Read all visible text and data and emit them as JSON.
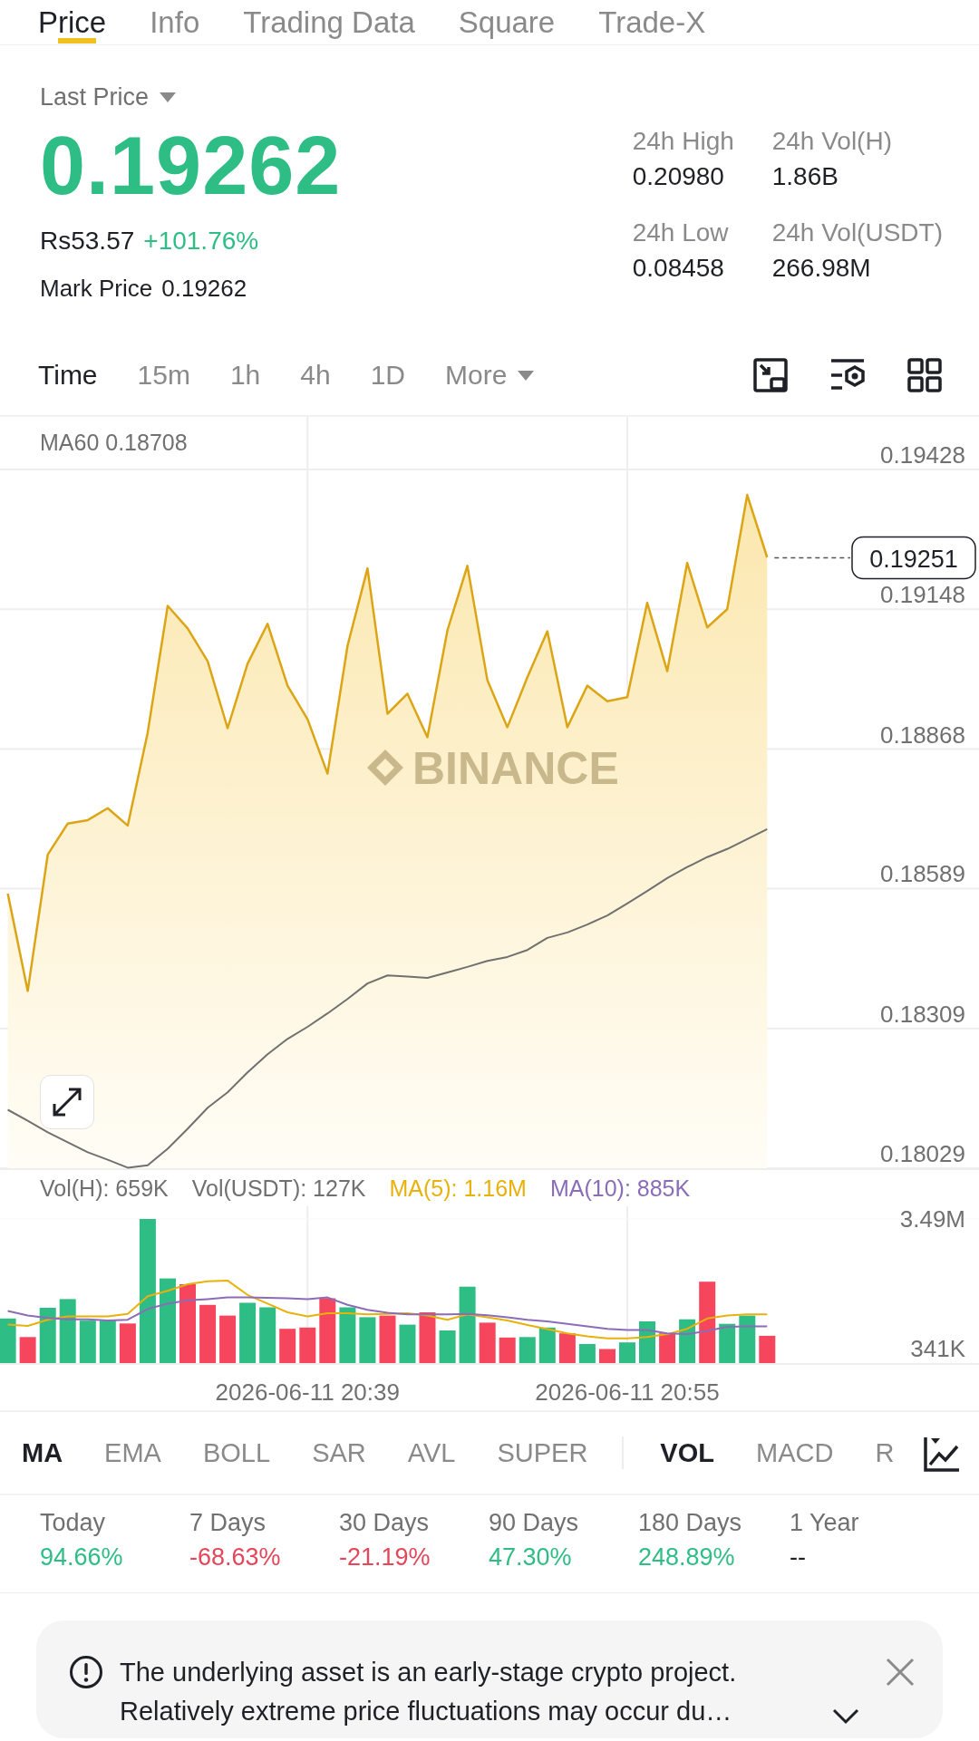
{
  "top_tabs": [
    {
      "label": "Price",
      "selected": true
    },
    {
      "label": "Info",
      "selected": false
    },
    {
      "label": "Trading Data",
      "selected": false
    },
    {
      "label": "Square",
      "selected": false
    },
    {
      "label": "Trade-X",
      "selected": false
    }
  ],
  "price_header": {
    "selector_label": "Last Price",
    "last_price": "0.19262",
    "fiat_price": "Rs53.57",
    "change": "+101.76%",
    "mark_price_label": "Mark Price",
    "mark_price": "0.19262"
  },
  "stats": [
    {
      "label": "24h High",
      "value": "0.20980"
    },
    {
      "label": "24h Vol(H)",
      "value": "1.86B"
    },
    {
      "label": "24h Low",
      "value": "0.08458"
    },
    {
      "label": "24h Vol(USDT)",
      "value": "266.98M"
    }
  ],
  "intervals": [
    {
      "label": "Time",
      "selected": true,
      "kind": "option"
    },
    {
      "label": "15m",
      "selected": false,
      "kind": "option"
    },
    {
      "label": "1h",
      "selected": false,
      "kind": "option"
    },
    {
      "label": "4h",
      "selected": false,
      "kind": "option"
    },
    {
      "label": "1D",
      "selected": false,
      "kind": "option"
    },
    {
      "label": "More",
      "selected": false,
      "kind": "dropdown"
    }
  ],
  "price_chart": {
    "legend": "MA60 0.18708",
    "watermark": "BINANCE",
    "current_price_tag": "0.19251",
    "chart_data": {
      "type": "line",
      "grid": true,
      "categories": [
        null,
        null,
        null,
        null,
        null,
        null,
        null,
        null,
        null,
        null,
        null,
        null,
        null,
        null,
        null,
        null,
        null,
        null,
        null,
        null,
        null,
        null,
        null,
        null,
        null,
        null,
        null,
        null,
        null,
        null,
        null,
        null,
        null,
        null,
        null,
        null,
        null,
        null,
        null
      ],
      "ylim": [
        0.18029,
        0.19428
      ],
      "yticks": [
        0.19428,
        0.19148,
        0.18868,
        0.18589,
        0.18309,
        0.18029
      ],
      "series": [
        {
          "type": "area",
          "color": "#dca515",
          "values": [
            0.18579,
            0.18384,
            0.18657,
            0.18719,
            0.18726,
            0.1875,
            0.18715,
            0.18901,
            0.19155,
            0.1911,
            0.19044,
            0.1891,
            0.19039,
            0.19119,
            0.18995,
            0.18928,
            0.18819,
            0.19075,
            0.1923,
            0.18939,
            0.18979,
            0.18892,
            0.19106,
            0.19235,
            0.19006,
            0.18912,
            0.19012,
            0.19104,
            0.18912,
            0.18995,
            0.18964,
            0.18972,
            0.19161,
            0.19024,
            0.19241,
            0.19112,
            0.19148,
            0.19377,
            0.19252
          ]
        },
        {
          "color": "#707070",
          "values": [
            0.18146,
            0.18124,
            0.18101,
            0.18081,
            0.18061,
            0.18046,
            0.1803,
            0.18035,
            0.18068,
            0.18108,
            0.1815,
            0.18181,
            0.18221,
            0.18257,
            0.18288,
            0.18312,
            0.18339,
            0.18368,
            0.18399,
            0.18415,
            0.18413,
            0.1841,
            0.18421,
            0.18432,
            0.18444,
            0.18452,
            0.18466,
            0.1849,
            0.18501,
            0.18517,
            0.18535,
            0.18559,
            0.18584,
            0.1861,
            0.18632,
            0.18652,
            0.18668,
            0.18688,
            0.18708
          ]
        }
      ]
    }
  },
  "volume_chart": {
    "legend": [
      {
        "text": "Vol(H): 659K",
        "color": "#707070"
      },
      {
        "text": "Vol(USDT): 127K",
        "color": "#707070"
      },
      {
        "text": "MA(5): 1.16M",
        "color": "#e8b10b"
      },
      {
        "text": "MA(10): 885K",
        "color": "#8a6cb8"
      }
    ],
    "chart_data": {
      "type": "bar",
      "grid": true,
      "categories": [
        null,
        null,
        null,
        null,
        null,
        null,
        null,
        null,
        null,
        null,
        null,
        null,
        null,
        null,
        null,
        "2026-06-11 20:39",
        null,
        null,
        null,
        null,
        null,
        null,
        null,
        null,
        null,
        null,
        null,
        null,
        null,
        null,
        null,
        "2026-06-11 20:55",
        null,
        null,
        null,
        null,
        null,
        null,
        null
      ],
      "ylim": [
        0,
        3490000
      ],
      "yticks": [
        {
          "value": 3490000,
          "label": "3.49M"
        },
        {
          "value": 341000,
          "label": "341K"
        }
      ],
      "series": [
        {
          "color": "#2ebd85",
          "values": [
            1080000,
            null,
            1340000,
            1550000,
            1030000,
            1030000,
            null,
            3490000,
            2050000,
            null,
            null,
            null,
            1460000,
            1350000,
            null,
            null,
            null,
            1350000,
            1110000,
            null,
            930000,
            null,
            790000,
            1850000,
            null,
            null,
            630000,
            860000,
            null,
            460000,
            null,
            500000,
            1010000,
            null,
            1060000,
            null,
            950000,
            1150000,
            null
          ]
        },
        {
          "color": "#f6465d",
          "values": [
            null,
            630000,
            null,
            null,
            null,
            null,
            960000,
            null,
            null,
            1910000,
            1410000,
            1150000,
            null,
            null,
            830000,
            860000,
            1570000,
            null,
            null,
            1150000,
            null,
            1230000,
            null,
            null,
            980000,
            620000,
            null,
            null,
            720000,
            null,
            340000,
            null,
            null,
            720000,
            null,
            1970000,
            null,
            null,
            660000
          ]
        },
        {
          "type": "line",
          "color": "#e8b10b",
          "values": [
            930000,
            900000,
            1050000,
            1130000,
            1130000,
            1130000,
            1190000,
            1620000,
            1750000,
            1910000,
            1980000,
            2000000,
            1650000,
            1440000,
            1230000,
            1130000,
            1210000,
            1210000,
            1180000,
            1190000,
            1210000,
            1150000,
            1050000,
            1180000,
            1110000,
            1030000,
            920000,
            820000,
            720000,
            650000,
            600000,
            600000,
            630000,
            700000,
            830000,
            1080000,
            1150000,
            1180000,
            1180000
          ]
        },
        {
          "type": "line",
          "color": "#8a6cb8",
          "values": [
            1260000,
            1150000,
            1090000,
            1060000,
            1060000,
            1030000,
            1050000,
            1310000,
            1440000,
            1520000,
            1550000,
            1590000,
            1590000,
            1580000,
            1570000,
            1550000,
            1590000,
            1410000,
            1290000,
            1220000,
            1180000,
            1180000,
            1180000,
            1190000,
            1160000,
            1110000,
            1050000,
            1010000,
            950000,
            890000,
            830000,
            800000,
            800000,
            720000,
            700000,
            780000,
            880000,
            890000,
            890000
          ]
        }
      ]
    }
  },
  "main_indicators": [
    {
      "label": "MA",
      "selected": true
    },
    {
      "label": "EMA",
      "selected": false
    },
    {
      "label": "BOLL",
      "selected": false
    },
    {
      "label": "SAR",
      "selected": false
    },
    {
      "label": "AVL",
      "selected": false
    },
    {
      "label": "SUPER",
      "selected": false
    }
  ],
  "sub_indicators": [
    {
      "label": "VOL",
      "selected": true
    },
    {
      "label": "MACD",
      "selected": false
    },
    {
      "label": "R",
      "selected": false
    }
  ],
  "performance": [
    {
      "label": "Today",
      "value": "94.66%",
      "color": "#2ebd85"
    },
    {
      "label": "7 Days",
      "value": "-68.63%",
      "color": "#e2475a"
    },
    {
      "label": "30 Days",
      "value": "-21.19%",
      "color": "#e2475a"
    },
    {
      "label": "90 Days",
      "value": "47.30%",
      "color": "#2ebd85"
    },
    {
      "label": "180 Days",
      "value": "248.89%",
      "color": "#2ebd85"
    },
    {
      "label": "1 Year",
      "value": "--",
      "color": "#1e2026"
    }
  ],
  "notice": {
    "lines": [
      "The underlying asset is an early-stage crypto project.",
      "Relatively extreme price fluctuations may occur du…"
    ]
  }
}
